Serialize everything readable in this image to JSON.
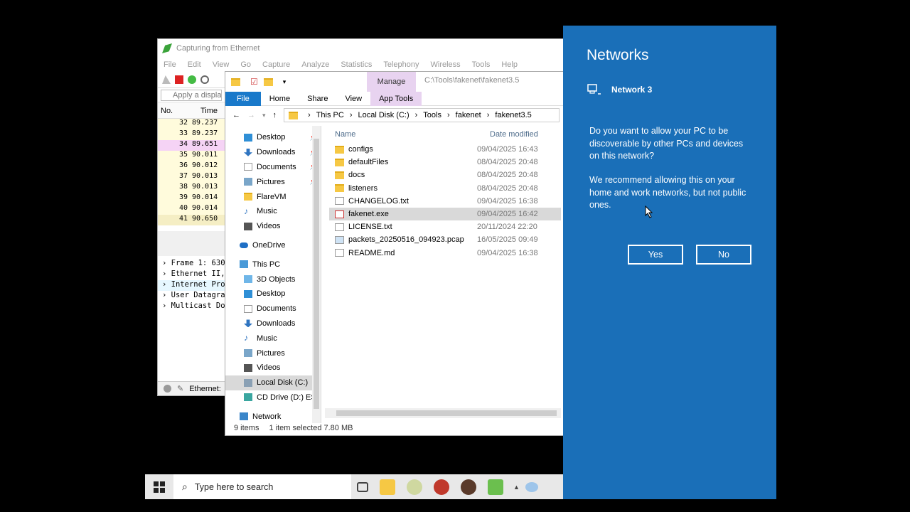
{
  "wireshark": {
    "title": "Capturing from Ethernet",
    "menu": [
      "File",
      "Edit",
      "View",
      "Go",
      "Capture",
      "Analyze",
      "Statistics",
      "Telephony",
      "Wireless",
      "Tools",
      "Help"
    ],
    "filter_placeholder": "Apply a display f",
    "columns": [
      "No.",
      "Time"
    ],
    "rows": [
      {
        "no": "32",
        "time": "89.237"
      },
      {
        "no": "33",
        "time": "89.237"
      },
      {
        "no": "34",
        "time": "89.651"
      },
      {
        "no": "35",
        "time": "90.011"
      },
      {
        "no": "36",
        "time": "90.012"
      },
      {
        "no": "37",
        "time": "90.013"
      },
      {
        "no": "38",
        "time": "90.013"
      },
      {
        "no": "39",
        "time": "90.014"
      },
      {
        "no": "40",
        "time": "90.014"
      },
      {
        "no": "41",
        "time": "90.650"
      }
    ],
    "details": [
      "Frame 1: 630",
      "Ethernet II,",
      "Internet Pro",
      "User Datagra",
      "Multicast Do"
    ],
    "status": "Ethernet:"
  },
  "explorer": {
    "manage_tab": "Manage",
    "path_title": "C:\\Tools\\fakenet\\fakenet3.5",
    "ribbon": {
      "file": "File",
      "home": "Home",
      "share": "Share",
      "view": "View",
      "app_tools": "App Tools"
    },
    "breadcrumb": [
      "This PC",
      "Local Disk (C:)",
      "Tools",
      "fakenet",
      "fakenet3.5"
    ],
    "nav": [
      {
        "label": "Desktop",
        "pinned": true
      },
      {
        "label": "Downloads",
        "pinned": true
      },
      {
        "label": "Documents",
        "pinned": true
      },
      {
        "label": "Pictures",
        "pinned": true
      },
      {
        "label": "FlareVM",
        "pinned": false
      },
      {
        "label": "Music",
        "pinned": false
      },
      {
        "label": "Videos",
        "pinned": false
      },
      {
        "label": "OneDrive",
        "pinned": false
      },
      {
        "label": "This PC",
        "pinned": false
      },
      {
        "label": "3D Objects",
        "pinned": false
      },
      {
        "label": "Desktop",
        "pinned": false
      },
      {
        "label": "Documents",
        "pinned": false
      },
      {
        "label": "Downloads",
        "pinned": false
      },
      {
        "label": "Music",
        "pinned": false
      },
      {
        "label": "Pictures",
        "pinned": false
      },
      {
        "label": "Videos",
        "pinned": false
      },
      {
        "label": "Local Disk (C:)",
        "pinned": false
      },
      {
        "label": "CD Drive (D:) ESI",
        "pinned": false
      },
      {
        "label": "Network",
        "pinned": false
      }
    ],
    "columns": {
      "name": "Name",
      "date": "Date modified"
    },
    "files": [
      {
        "name": "configs",
        "date": "09/04/2025 16:43",
        "type": "folder"
      },
      {
        "name": "defaultFiles",
        "date": "08/04/2025 20:48",
        "type": "folder"
      },
      {
        "name": "docs",
        "date": "08/04/2025 20:48",
        "type": "folder"
      },
      {
        "name": "listeners",
        "date": "08/04/2025 20:48",
        "type": "folder"
      },
      {
        "name": "CHANGELOG.txt",
        "date": "09/04/2025 16:38",
        "type": "doc"
      },
      {
        "name": "fakenet.exe",
        "date": "09/04/2025 16:42",
        "type": "exe"
      },
      {
        "name": "LICENSE.txt",
        "date": "20/11/2024 22:20",
        "type": "doc"
      },
      {
        "name": "packets_20250516_094923.pcap",
        "date": "16/05/2025 09:49",
        "type": "pcap"
      },
      {
        "name": "README.md",
        "date": "09/04/2025 16:38",
        "type": "doc"
      }
    ],
    "status": {
      "count": "9 items",
      "selected": "1 item selected  7.80 MB"
    }
  },
  "networks": {
    "title": "Networks",
    "network_name": "Network 3",
    "question": "Do you want to allow your PC to be discoverable by other PCs and devices on this network?",
    "recommendation": "We recommend allowing this on your home and work networks, but not public ones.",
    "yes": "Yes",
    "no": "No",
    "accent": "#1a6fb8"
  },
  "taskbar": {
    "search_placeholder": "Type here to search"
  }
}
